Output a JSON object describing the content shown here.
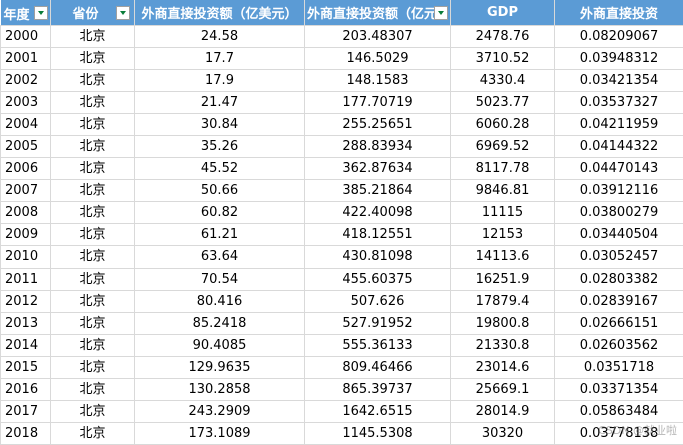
{
  "header": {
    "year": "年度",
    "province": "省份",
    "fdi_usd": "外商直接投资额（亿美元）",
    "fdi_cny": "外商直接投资额（亿元）",
    "gdp": "GDP",
    "fdi_ratio": "外商直接投资"
  },
  "rows": [
    {
      "year": "2000",
      "province": "北京",
      "fdi_usd": "24.58",
      "fdi_cny": "203.48307",
      "gdp": "2478.76",
      "ratio": "0.08209067"
    },
    {
      "year": "2001",
      "province": "北京",
      "fdi_usd": "17.7",
      "fdi_cny": "146.5029",
      "gdp": "3710.52",
      "ratio": "0.03948312"
    },
    {
      "year": "2002",
      "province": "北京",
      "fdi_usd": "17.9",
      "fdi_cny": "148.1583",
      "gdp": "4330.4",
      "ratio": "0.03421354"
    },
    {
      "year": "2003",
      "province": "北京",
      "fdi_usd": "21.47",
      "fdi_cny": "177.70719",
      "gdp": "5023.77",
      "ratio": "0.03537327"
    },
    {
      "year": "2004",
      "province": "北京",
      "fdi_usd": "30.84",
      "fdi_cny": "255.25651",
      "gdp": "6060.28",
      "ratio": "0.04211959"
    },
    {
      "year": "2005",
      "province": "北京",
      "fdi_usd": "35.26",
      "fdi_cny": "288.83934",
      "gdp": "6969.52",
      "ratio": "0.04144322"
    },
    {
      "year": "2006",
      "province": "北京",
      "fdi_usd": "45.52",
      "fdi_cny": "362.87634",
      "gdp": "8117.78",
      "ratio": "0.04470143"
    },
    {
      "year": "2007",
      "province": "北京",
      "fdi_usd": "50.66",
      "fdi_cny": "385.21864",
      "gdp": "9846.81",
      "ratio": "0.03912116"
    },
    {
      "year": "2008",
      "province": "北京",
      "fdi_usd": "60.82",
      "fdi_cny": "422.40098",
      "gdp": "11115",
      "ratio": "0.03800279"
    },
    {
      "year": "2009",
      "province": "北京",
      "fdi_usd": "61.21",
      "fdi_cny": "418.12551",
      "gdp": "12153",
      "ratio": "0.03440504"
    },
    {
      "year": "2010",
      "province": "北京",
      "fdi_usd": "63.64",
      "fdi_cny": "430.81098",
      "gdp": "14113.6",
      "ratio": "0.03052457"
    },
    {
      "year": "2011",
      "province": "北京",
      "fdi_usd": "70.54",
      "fdi_cny": "455.60375",
      "gdp": "16251.9",
      "ratio": "0.02803382"
    },
    {
      "year": "2012",
      "province": "北京",
      "fdi_usd": "80.416",
      "fdi_cny": "507.626",
      "gdp": "17879.4",
      "ratio": "0.02839167"
    },
    {
      "year": "2013",
      "province": "北京",
      "fdi_usd": "85.2418",
      "fdi_cny": "527.91952",
      "gdp": "19800.8",
      "ratio": "0.02666151"
    },
    {
      "year": "2014",
      "province": "北京",
      "fdi_usd": "90.4085",
      "fdi_cny": "555.36133",
      "gdp": "21330.8",
      "ratio": "0.02603562"
    },
    {
      "year": "2015",
      "province": "北京",
      "fdi_usd": "129.9635",
      "fdi_cny": "809.46466",
      "gdp": "23014.6",
      "ratio": "0.0351718"
    },
    {
      "year": "2016",
      "province": "北京",
      "fdi_usd": "130.2858",
      "fdi_cny": "865.39737",
      "gdp": "25669.1",
      "ratio": "0.03371354"
    },
    {
      "year": "2017",
      "province": "北京",
      "fdi_usd": "243.2909",
      "fdi_cny": "1642.6515",
      "gdp": "28014.9",
      "ratio": "0.05863484"
    },
    {
      "year": "2018",
      "province": "北京",
      "fdi_usd": "173.1089",
      "fdi_cny": "1145.5308",
      "gdp": "30320",
      "ratio": "0.03778138"
    }
  ],
  "watermark": "CSDN @就业啦"
}
